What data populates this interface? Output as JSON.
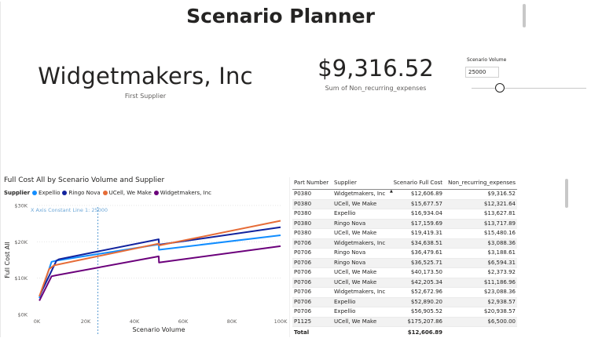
{
  "page": {
    "title": "Scenario Planner"
  },
  "supplier_card": {
    "value": "Widgetmakers, Inc",
    "caption": "First Supplier"
  },
  "kpi_card": {
    "value": "$9,316.52",
    "caption": "Sum of Non_recurring_expenses"
  },
  "slicer": {
    "title": "Scenario Volume",
    "value": "25000",
    "slider_fraction": 0.25
  },
  "chart": {
    "title": "Full Cost All by Scenario Volume and Supplier",
    "legend_title": "Supplier"
  },
  "chart_data": {
    "type": "line",
    "title": "Full Cost All by Scenario Volume and Supplier",
    "xlabel": "Scenario Volume",
    "ylabel": "Full Cost All",
    "xlim": [
      0,
      100000
    ],
    "ylim": [
      0,
      30000
    ],
    "x_ticks": [
      "0K",
      "20K",
      "40K",
      "60K",
      "80K",
      "100K"
    ],
    "y_ticks": [
      "$0K",
      "$10K",
      "$20K",
      "$30K"
    ],
    "x_tick_values": [
      0,
      20000,
      40000,
      60000,
      80000,
      100000
    ],
    "y_tick_values": [
      0,
      10000,
      20000,
      30000
    ],
    "constant_line": {
      "label": "X Axis Constant Line 1: 25000",
      "x": 25000,
      "color": "#6ea8d8"
    },
    "grid": true,
    "legend_position": "top-left",
    "series": [
      {
        "name": "Expellio",
        "color": "#118DFF",
        "points": [
          [
            1000,
            4500
          ],
          [
            6000,
            14500
          ],
          [
            8000,
            14800
          ],
          [
            50000,
            19300
          ],
          [
            50100,
            17800
          ],
          [
            100000,
            21800
          ]
        ]
      },
      {
        "name": "Ringo Nova",
        "color": "#12239E",
        "points": [
          [
            1000,
            5000
          ],
          [
            8000,
            14800
          ],
          [
            9000,
            15200
          ],
          [
            50000,
            20700
          ],
          [
            50100,
            19200
          ],
          [
            100000,
            24000
          ]
        ]
      },
      {
        "name": "UCell, We Make",
        "color": "#E66C37",
        "points": [
          [
            1000,
            5000
          ],
          [
            5000,
            12500
          ],
          [
            7000,
            13500
          ],
          [
            50000,
            19500
          ],
          [
            50100,
            19000
          ],
          [
            100000,
            25800
          ]
        ]
      },
      {
        "name": "Widgetmakers, Inc",
        "color": "#6B007B",
        "points": [
          [
            1000,
            3800
          ],
          [
            6000,
            10500
          ],
          [
            8000,
            10800
          ],
          [
            50000,
            16000
          ],
          [
            50100,
            14300
          ],
          [
            100000,
            18800
          ]
        ]
      }
    ]
  },
  "table": {
    "columns": [
      "Part Number",
      "Supplier",
      "Scenario Full Cost",
      "Non_recurring_expenses"
    ],
    "rows": [
      [
        "P0380",
        "Widgetmakers, Inc",
        "$12,606.89",
        "$9,316.52"
      ],
      [
        "P0380",
        "UCell, We Make",
        "$15,677.57",
        "$12,321.64"
      ],
      [
        "P0380",
        "Expellio",
        "$16,934.04",
        "$13,627.81"
      ],
      [
        "P0380",
        "Ringo Nova",
        "$17,159.69",
        "$13,717.89"
      ],
      [
        "P0380",
        "UCell, We Make",
        "$19,419.31",
        "$15,480.16"
      ],
      [
        "P0706",
        "Widgetmakers, Inc",
        "$34,638.51",
        "$3,088.36"
      ],
      [
        "P0706",
        "Ringo Nova",
        "$36,479.61",
        "$3,188.61"
      ],
      [
        "P0706",
        "Ringo Nova",
        "$36,525.71",
        "$6,594.31"
      ],
      [
        "P0706",
        "UCell, We Make",
        "$40,173.50",
        "$2,373.92"
      ],
      [
        "P0706",
        "UCell, We Make",
        "$42,205.34",
        "$11,186.96"
      ],
      [
        "P0706",
        "Widgetmakers, Inc",
        "$52,672.96",
        "$23,088.36"
      ],
      [
        "P0706",
        "Expellio",
        "$52,890.20",
        "$2,938.57"
      ],
      [
        "P0706",
        "Expellio",
        "$56,905.52",
        "$20,938.57"
      ],
      [
        "P1125",
        "UCell, We Make",
        "$175,207.86",
        "$6,500.00"
      ]
    ],
    "total": {
      "label": "Total",
      "full_cost": "$12,606.89",
      "non_recurring": ""
    }
  }
}
